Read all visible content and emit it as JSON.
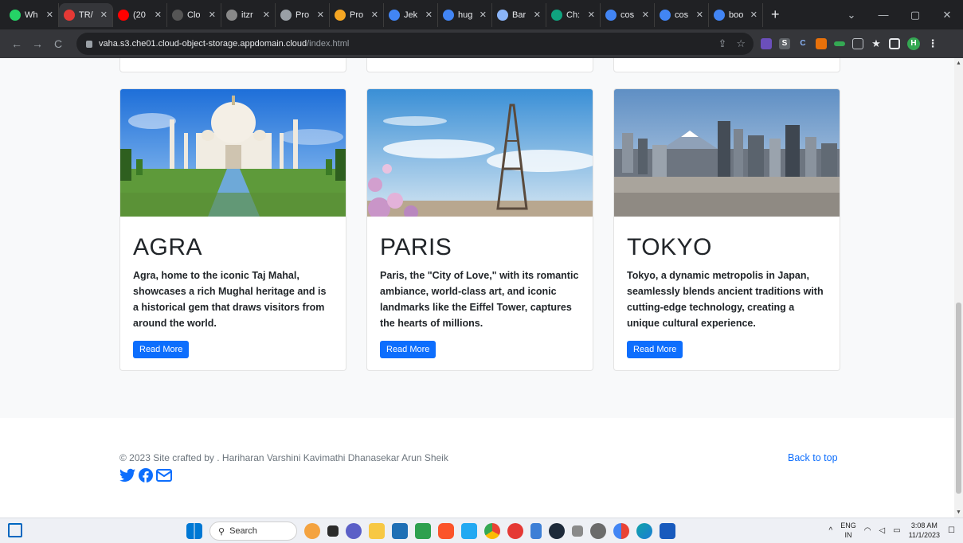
{
  "browser": {
    "tabs": [
      {
        "title": "Wh",
        "color": "#25d366"
      },
      {
        "title": "TR/",
        "color": "#e53935",
        "active": true
      },
      {
        "title": "(20",
        "color": "#ff0000"
      },
      {
        "title": "Clo",
        "color": "#555555"
      },
      {
        "title": "itzr",
        "color": "#888888"
      },
      {
        "title": "Pro",
        "color": "#9aa0a6"
      },
      {
        "title": "Pro",
        "color": "#f5a623"
      },
      {
        "title": "Jek",
        "color": "#4285f4"
      },
      {
        "title": "hug",
        "color": "#4285f4"
      },
      {
        "title": "Bar",
        "color": "#8ab4f8"
      },
      {
        "title": "Ch:",
        "color": "#10a37f"
      },
      {
        "title": "cos",
        "color": "#4285f4"
      },
      {
        "title": "cos",
        "color": "#4285f4"
      },
      {
        "title": "boo",
        "color": "#4285f4"
      }
    ],
    "url_host": "vaha.s3.che01.cloud-object-storage.appdomain.cloud",
    "url_path": "/index.html",
    "ext_letters": [
      "S",
      "C"
    ]
  },
  "cards": [
    {
      "title": "AGRA",
      "text": "Agra, home to the iconic Taj Mahal, showcases a rich Mughal heritage and is a historical gem that draws visitors from around the world.",
      "button": "Read More"
    },
    {
      "title": "PARIS",
      "text": "Paris, the \"City of Love,\" with its romantic ambiance, world-class art, and iconic landmarks like the Eiffel Tower, captures the hearts of millions.",
      "button": "Read More"
    },
    {
      "title": "TOKYO",
      "text": "Tokyo, a dynamic metropolis in Japan, seamlessly blends ancient traditions with cutting-edge technology, creating a unique cultural experience.",
      "button": "Read More"
    }
  ],
  "footer": {
    "copyright": "© 2023 Site crafted by . Hariharan Varshini Kavimathi Dhanasekar Arun Sheik",
    "back_to_top": "Back to top"
  },
  "taskbar": {
    "search_label": "Search",
    "lang_top": "ENG",
    "lang_bottom": "IN",
    "time": "3:08 AM",
    "date": "11/1/2023"
  },
  "colors": {
    "primary": "#0d6efd",
    "chrome_dark": "#202124",
    "chrome_toolbar": "#35363a",
    "album_bg": "#f8f9fa"
  }
}
